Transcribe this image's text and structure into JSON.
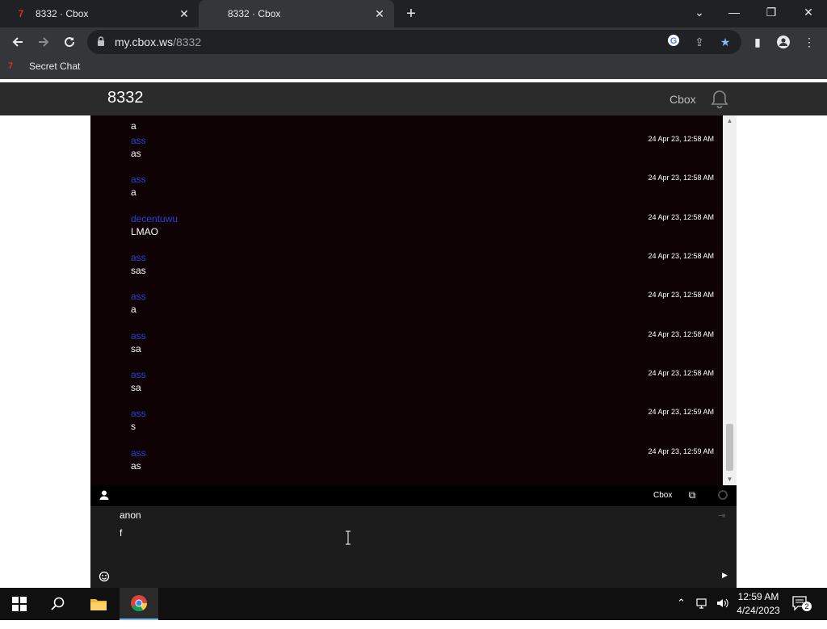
{
  "browser": {
    "tabs": [
      {
        "title": "8332 · Cbox",
        "favicon": "7",
        "active": false
      },
      {
        "title": "8332 · Cbox",
        "favicon": "7",
        "active": true
      }
    ],
    "url_host": "my.cbox.ws",
    "url_path": "/8332",
    "bookmarks": [
      {
        "label": "Secret Chat",
        "favicon": "7"
      }
    ]
  },
  "site": {
    "title": "8332",
    "brand": "Cbox"
  },
  "chat": {
    "messages": [
      {
        "name": "ass",
        "text": "as",
        "time": "24 Apr 23, 12:58 AM"
      },
      {
        "name": "ass",
        "text": "a",
        "time": "24 Apr 23, 12:58 AM"
      },
      {
        "name": "decentuwu",
        "text": "LMAO",
        "time": "24 Apr 23, 12:58 AM"
      },
      {
        "name": "ass",
        "text": "sas",
        "time": "24 Apr 23, 12:58 AM"
      },
      {
        "name": "ass",
        "text": "a",
        "time": "24 Apr 23, 12:58 AM"
      },
      {
        "name": "ass",
        "text": "sa",
        "time": "24 Apr 23, 12:58 AM"
      },
      {
        "name": "ass",
        "text": "sa",
        "time": "24 Apr 23, 12:58 AM"
      },
      {
        "name": "ass",
        "text": "s",
        "time": "24 Apr 23, 12:59 AM"
      },
      {
        "name": "ass",
        "text": "as",
        "time": "24 Apr 23, 12:59 AM"
      }
    ],
    "partial_top_text": "a",
    "bar_label": "Cbox",
    "compose": {
      "name": "anon",
      "text": "f"
    }
  },
  "taskbar": {
    "time": "12:59 AM",
    "date": "4/24/2023",
    "notification_count": "2"
  },
  "colors": {
    "chat_bg": "#0f0204",
    "username": "#2f3dd8",
    "header_bg": "#2b2b2b"
  }
}
